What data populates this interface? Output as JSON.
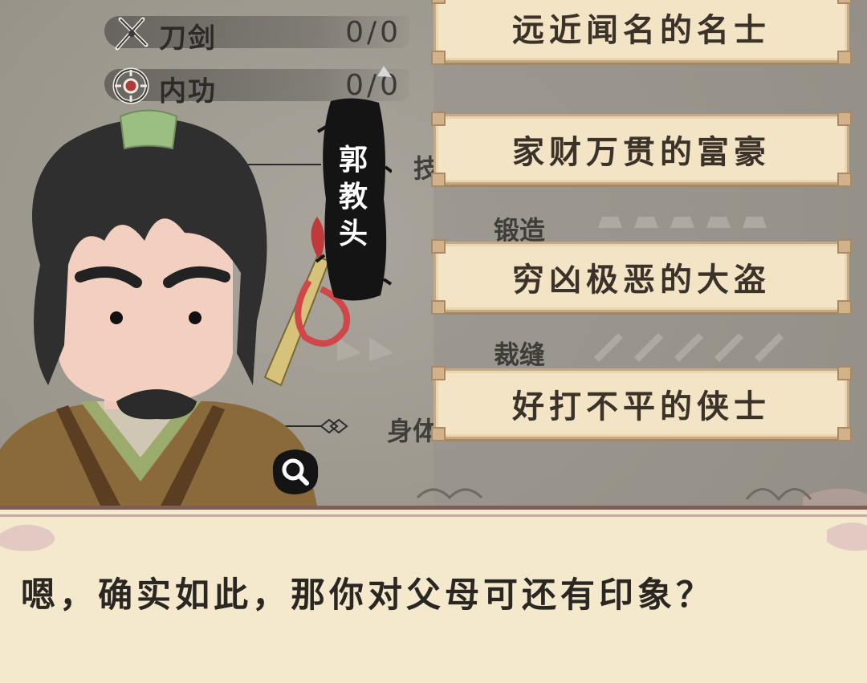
{
  "stats": [
    {
      "icon": "sword-icon",
      "label": "刀剑",
      "value": "0/0"
    },
    {
      "icon": "inner-power-icon",
      "label": "内功",
      "value": "0/0"
    }
  ],
  "background_labels": {
    "skill_partial": "技",
    "forging": "锻造",
    "tailoring": "裁缝",
    "body_partial": "身体"
  },
  "npc": {
    "name": "郭教头"
  },
  "choices": [
    {
      "label": "远近闻名的名士"
    },
    {
      "label": "家财万贯的富豪"
    },
    {
      "label": "穷凶极恶的大盗"
    },
    {
      "label": "好打不平的侠士"
    }
  ],
  "dialog": {
    "text": "嗯，确实如此，那你对父母可还有印象？"
  },
  "inspect": {
    "icon": "magnifier-icon"
  },
  "colors": {
    "choice_bg": "#f2e4c5",
    "dialog_bg": "#f4e8cd",
    "ink_black": "#151515",
    "background": "#9a958b"
  }
}
